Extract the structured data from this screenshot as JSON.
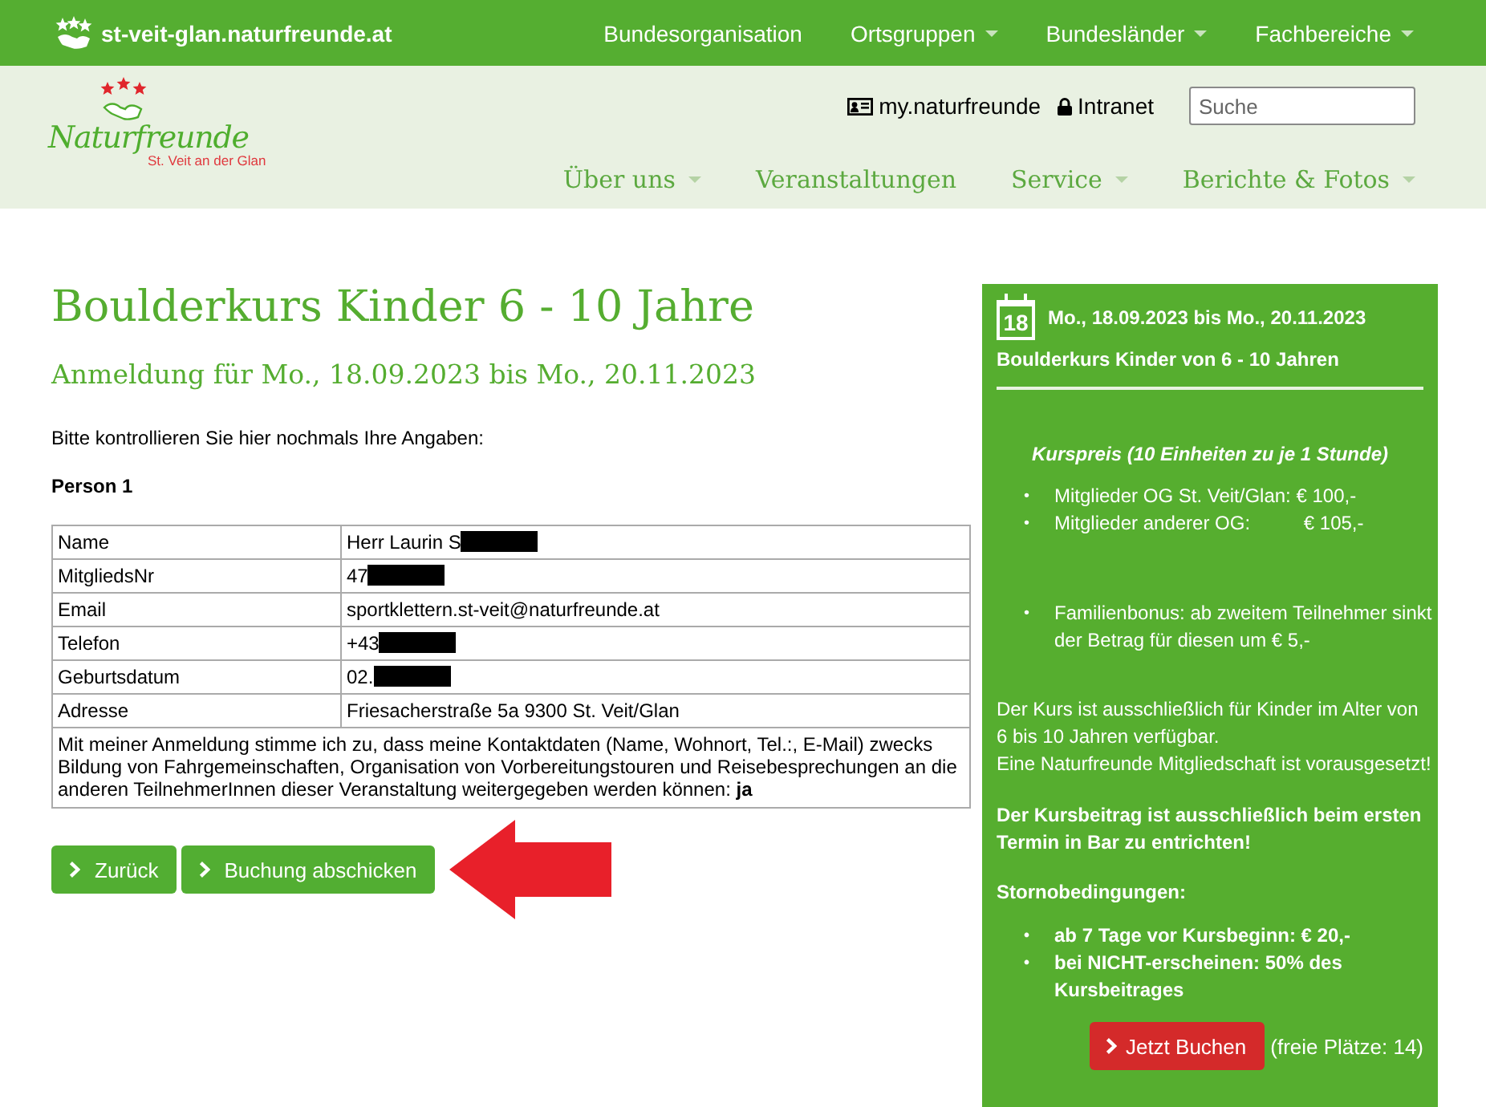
{
  "top_bar": {
    "site": "st-veit-glan.naturfreunde.at",
    "links": [
      {
        "label": "Bundesorganisation",
        "dropdown": false
      },
      {
        "label": "Ortsgruppen",
        "dropdown": true
      },
      {
        "label": "Bundesländer",
        "dropdown": true
      },
      {
        "label": "Fachbereiche",
        "dropdown": true
      }
    ]
  },
  "header": {
    "logo": {
      "name": "Naturfreunde",
      "subtitle": "St. Veit an der Glan"
    },
    "account_link": "my.naturfreunde",
    "intranet_link": "Intranet",
    "search": {
      "placeholder": "Suche"
    },
    "nav": [
      {
        "label": "Über uns",
        "dropdown": true
      },
      {
        "label": "Veranstaltungen",
        "dropdown": false
      },
      {
        "label": "Service",
        "dropdown": true
      },
      {
        "label": "Berichte & Fotos",
        "dropdown": true
      }
    ]
  },
  "main": {
    "title": "Boulderkurs Kinder 6 - 10 Jahre",
    "subtitle": "Anmeldung für Mo., 18.09.2023 bis Mo., 20.11.2023",
    "intro": "Bitte kontrollieren Sie hier nochmals Ihre Angaben:",
    "person_heading": "Person 1",
    "details": [
      {
        "label": "Name",
        "value": "Herr Laurin S",
        "redacted": true
      },
      {
        "label": "MitgliedsNr",
        "value": "47",
        "redacted": true
      },
      {
        "label": "Email",
        "value": "sportklettern.st-veit@naturfreunde.at",
        "redacted": false
      },
      {
        "label": "Telefon",
        "value": "+43",
        "redacted": true
      },
      {
        "label": "Geburtsdatum",
        "value": "02.",
        "redacted": true
      },
      {
        "label": "Adresse",
        "value": "Friesacherstraße 5a 9300 St. Veit/Glan",
        "redacted": false
      }
    ],
    "consent": "Mit meiner Anmeldung stimme ich zu, dass meine Kontaktdaten (Name, Wohnort, Tel.:, E-Mail) zwecks Bildung von Fahrgemeinschaften, Organisation von Vorbereitungstouren und Reisebesprechungen an die anderen TeilnehmerInnen dieser Veranstaltung weitergegeben werden können: **ja**",
    "buttons": [
      {
        "label": "Zurück"
      },
      {
        "label": "Buchung abschicken"
      }
    ]
  },
  "sidebar": {
    "calendar_day": "18",
    "date": "Mo., 18.09.2023 bis Mo., 20.11.2023",
    "course": "Boulderkurs Kinder von 6 - 10 Jahren",
    "price_heading": "Kurspreis (10 Einheiten zu je 1 Stunde)",
    "prices": [
      {
        "marker": "•",
        "text": "Mitglieder OG St. Veit/Glan: € 100,-"
      },
      {
        "marker": "•",
        "text": "Mitglieder anderer OG:          € 105,-"
      }
    ],
    "bonus": [
      {
        "marker": "•",
        "text": "Familienbonus: ab zweitem Teilnehmer sinkt der Betrag für diesen um € 5,-"
      }
    ],
    "notes": [
      "Der Kurs ist ausschließlich für Kinder im Alter von 6 bis 10 Jahren verfügbar.",
      "Eine Naturfreunde Mitgliedschaft ist vorausgesetzt!"
    ],
    "payment_note": "Der Kursbeitrag ist ausschließlich beim ersten Termin in Bar zu entrichten!",
    "cancellation_heading": "Stornobedingungen:",
    "cancellation": [
      {
        "marker": "•",
        "text": "ab 7 Tage vor Kursbeginn: € 20,-"
      },
      {
        "marker": "•",
        "text": "bei NICHT-erscheinen: 50% des Kursbeitrages"
      }
    ],
    "book_button": "Jetzt Buchen",
    "free_places": "(freie Plätze: 14)"
  }
}
